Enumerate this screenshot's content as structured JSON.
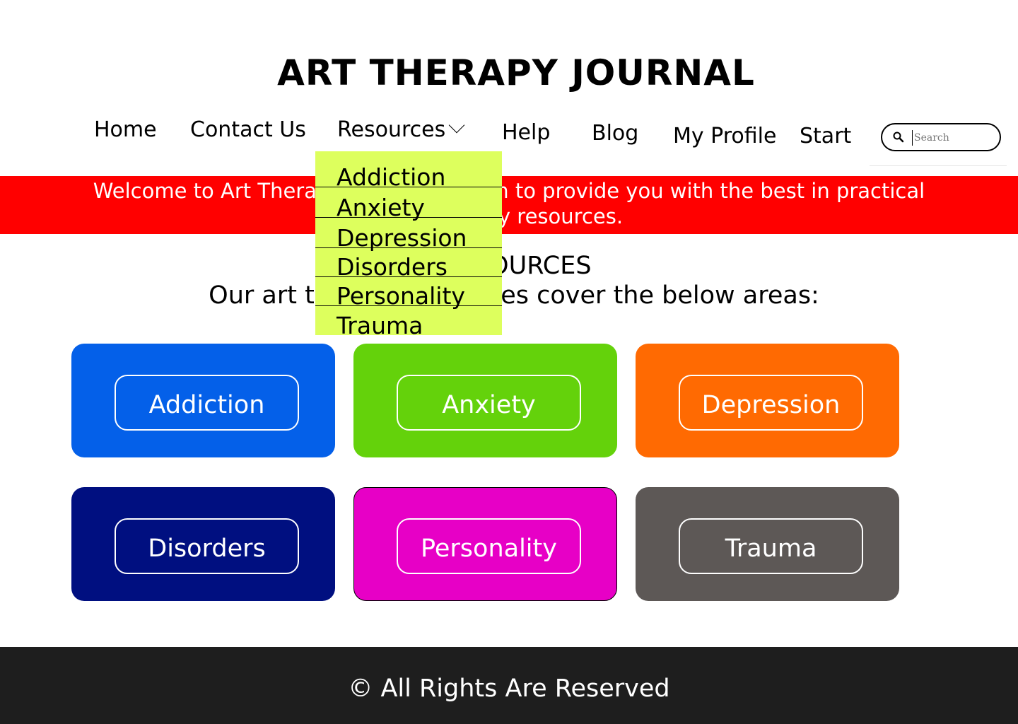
{
  "header": {
    "title": "ART THERAPY JOURNAL"
  },
  "nav": {
    "home": "Home",
    "contact": "Contact Us",
    "resources": "Resources",
    "help": "Help",
    "blog": "Blog",
    "profile": "My Profile",
    "start": "Start"
  },
  "search": {
    "placeholder": "Search",
    "value": ""
  },
  "banner": {
    "text": "Welcome to Art Therapy Journal. We aim to provide you with the best in practical art therapy resources."
  },
  "resources_section": {
    "heading": "RESOURCES",
    "subtitle": "Our art therapy resources cover the below areas:"
  },
  "dropdown": {
    "items": [
      "Addiction",
      "Anxiety",
      "Depression",
      "Disorders",
      "Personality",
      "Trauma"
    ]
  },
  "cards": [
    {
      "label": "Addiction",
      "color": "#0460e9"
    },
    {
      "label": "Anxiety",
      "color": "#64d20b"
    },
    {
      "label": "Depression",
      "color": "#ff6a02"
    },
    {
      "label": "Disorders",
      "color": "#000f80"
    },
    {
      "label": "Personality",
      "color": "#e700c6"
    },
    {
      "label": "Trauma",
      "color": "#5d5856"
    }
  ],
  "footer": {
    "text": "© All Rights Are Reserved"
  },
  "colors": {
    "banner": "#ff0000",
    "dropdown": "#ddff5d",
    "footer": "#1e1e1e"
  }
}
